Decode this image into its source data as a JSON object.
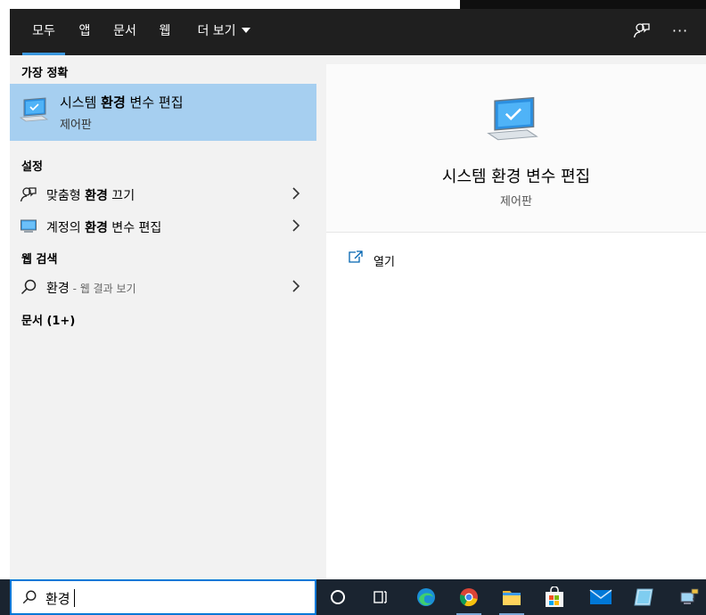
{
  "tabs": {
    "all": "모두",
    "apps": "앱",
    "documents": "문서",
    "web": "웹",
    "more": "더 보기"
  },
  "sections": {
    "best_match": "가장 정확",
    "settings": "설정",
    "web_search": "웹 검색",
    "documents": "문서 (1+)"
  },
  "best_match": {
    "title_pre": "시스템 ",
    "title_bold": "환경",
    "title_post": " 변수 편집",
    "subtitle": "제어판"
  },
  "settings_items": [
    {
      "pre": "맞춤형 ",
      "bold": "환경",
      "post": " 끄기"
    },
    {
      "pre": "계정의 ",
      "bold": "환경",
      "post": " 변수 편집"
    }
  ],
  "web_item": {
    "query": "환경",
    "hint": " - 웹 결과 보기"
  },
  "preview": {
    "title": "시스템 환경 변수 편집",
    "subtitle": "제어판",
    "open_label": "열기"
  },
  "search": {
    "query": "환경"
  },
  "colors": {
    "accent": "#0078d7",
    "selection": "#a6cff0",
    "topbar": "#1f1f1f",
    "taskbar": "#1a2430"
  },
  "icons": {
    "feedback": "feedback-icon",
    "more": "more-options-icon",
    "search": "search-icon",
    "chevron": "chevron-right-icon",
    "open": "open-external-icon"
  }
}
